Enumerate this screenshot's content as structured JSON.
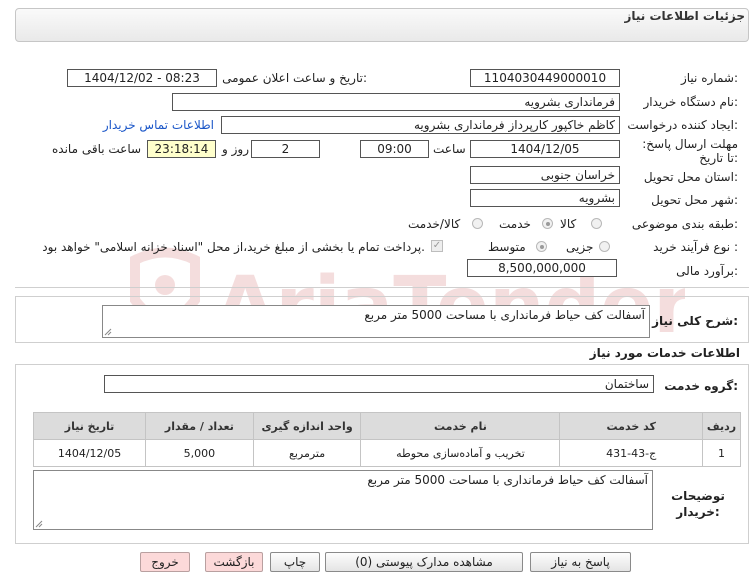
{
  "header": {
    "title": "جزئیات اطلاعات نیاز"
  },
  "form": {
    "need_number_label": "شماره نیاز:",
    "need_number": "1104030449000010",
    "announce_label": "تاریخ و ساعت اعلان عمومی:",
    "announce_value": "1404/12/02 - 08:23",
    "buyer_org_label": "نام دستگاه خریدار:",
    "buyer_org": "فرمانداری بشرویه",
    "creator_label": "ایجاد کننده درخواست:",
    "creator": "کاظم خاکپور کارپرداز فرمانداری بشرویه",
    "contact_link": "اطلاعات تماس خریدار",
    "deadline_label": "مهلت ارسال پاسخ: تا تاریخ:",
    "deadline_date": "1404/12/05",
    "time_label": "ساعت",
    "deadline_time": "09:00",
    "days_value": "2",
    "days_label": "روز و",
    "remaining_time": "23:18:14",
    "remaining_label": "ساعت باقی مانده",
    "province_label": "استان محل تحویل:",
    "province": "خراسان جنوبی",
    "city_label": "شهر محل تحویل:",
    "city": "بشرویه",
    "category_label": "طبقه بندی موضوعی:",
    "category_options": [
      "کالا",
      "خدمت",
      "کالا/خدمت"
    ],
    "category_selected": "خدمت",
    "purchase_label": "نوع فرآیند خرید :",
    "purchase_options": [
      "جزیی",
      "متوسط"
    ],
    "purchase_selected": "متوسط",
    "treasury_note": "پرداخت تمام یا بخشی از مبلغ خرید،از محل \"اسناد خزانه اسلامی\" خواهد بود.",
    "estimate_label": "برآورد مالی:",
    "estimate": "8,500,000,000"
  },
  "description": {
    "label": "شرح کلی نیاز:",
    "text": "آسفالت کف حیاط فرمانداری با مساحت 5000 متر مربع"
  },
  "services": {
    "section_title": "اطلاعات خدمات مورد نیاز",
    "group_label": "گروه خدمت:",
    "group_value": "ساختمان",
    "table": {
      "headers": [
        "ردیف",
        "کد خدمت",
        "نام خدمت",
        "واحد اندازه گیری",
        "تعداد / مقدار",
        "تاریخ نیاز"
      ],
      "rows": [
        [
          "1",
          "ج-43-431",
          "تخریب و آماده‌سازی محوطه",
          "مترمربع",
          "5,000",
          "1404/12/05"
        ]
      ]
    }
  },
  "buyer_notes": {
    "label": "توضیحات خریدار:",
    "text": "آسفالت کف حیاط فرمانداری با مساحت 5000 متر مربع"
  },
  "buttons": {
    "reply": "پاسخ به نیاز",
    "attachments": "مشاهده مدارک پیوستی (0)",
    "print": "چاپ",
    "back": "بازگشت",
    "exit": "خروج"
  },
  "watermark": {
    "text": "AriaTender.neT"
  }
}
